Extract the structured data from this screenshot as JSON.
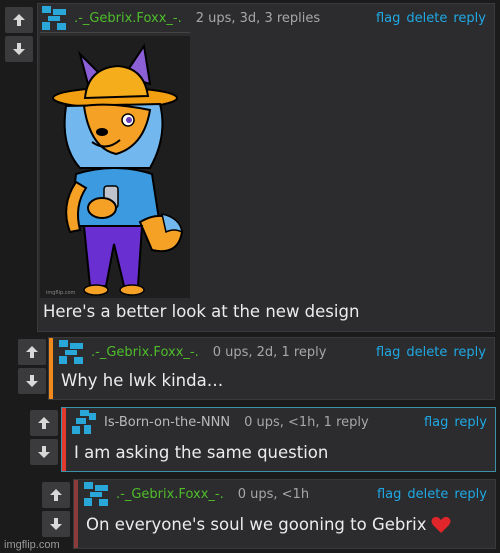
{
  "comments": [
    {
      "username": ".-_Gebrix.Foxx_-.",
      "meta": "2 ups, 3d, 3 replies",
      "actions": [
        "flag",
        "delete",
        "reply"
      ],
      "text": "Here's a better look at the new design",
      "has_image": true,
      "image_watermark": "imgflip.com"
    },
    {
      "username": ".-_Gebrix.Foxx_-.",
      "meta": "0 ups, 2d, 1 reply",
      "actions": [
        "flag",
        "delete",
        "reply"
      ],
      "text": "Why he lwk kinda…",
      "accent": "#f08a1c"
    },
    {
      "username": "Is-Born-on-the-NNN",
      "meta": "0 ups, <1h, 1 reply",
      "actions": [
        "flag",
        "reply"
      ],
      "text": "I am asking the same question",
      "accent": "#e03a2e"
    },
    {
      "username": ".-_Gebrix.Foxx_-.",
      "meta": "0 ups, <1h",
      "actions": [
        "flag",
        "delete",
        "reply"
      ],
      "text": "On everyone's soul we gooning to Gebrix",
      "text_emoji": "heart-icon",
      "accent": "#8c3b3b"
    }
  ],
  "footer": {
    "watermark": "imgflip.com"
  },
  "colors": {
    "background": "#1b1b1c",
    "panel": "#2c2c2e",
    "username": "#4fbd2b",
    "action_link": "#1fa8e4",
    "meta": "#a7a7a9"
  }
}
